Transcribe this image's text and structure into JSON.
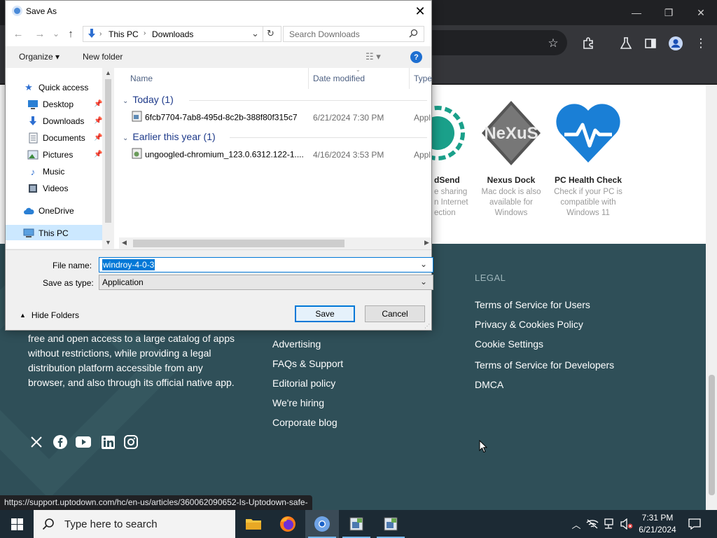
{
  "browser": {
    "window_controls": {
      "minimize": "—",
      "maximize": "❐",
      "close": "✕"
    }
  },
  "page": {
    "apps": [
      {
        "name": "dSend",
        "desc": "e sharing\nn Internet\nection"
      },
      {
        "name": "Nexus Dock",
        "logo_text": "NeXuS",
        "desc": "Mac dock is also available for Windows"
      },
      {
        "name": "PC Health Check",
        "desc": "Check if your PC is compatible with Windows 11"
      }
    ],
    "about_text": "free and open access to a large catalog of apps without restrictions, while providing a legal distribution platform accessible from any browser, and also through its official native app.",
    "company_links": [
      "Advertising",
      "FAQs & Support",
      "Editorial policy",
      "We're hiring",
      "Corporate blog"
    ],
    "legal": {
      "heading": "LEGAL",
      "links": [
        "Terms of Service for Users",
        "Privacy & Cookies Policy",
        "Cookie Settings",
        "Terms of Service for Developers",
        "DMCA"
      ]
    },
    "social_icons": [
      "x-icon",
      "facebook-icon",
      "youtube-icon",
      "linkedin-icon",
      "instagram-icon"
    ],
    "status_url": "https://support.uptodown.com/hc/en-us/articles/360062090652-Is-Uptodown-safe-"
  },
  "dialog": {
    "title": "Save As",
    "breadcrumb": [
      "This PC",
      "Downloads"
    ],
    "search_placeholder": "Search Downloads",
    "organize_label": "Organize ▾",
    "new_folder_label": "New folder",
    "nav_items": [
      {
        "label": "Quick access",
        "icon": "star-icon"
      },
      {
        "label": "Desktop",
        "icon": "desktop-icon",
        "pinned": true
      },
      {
        "label": "Downloads",
        "icon": "download-icon",
        "pinned": true
      },
      {
        "label": "Documents",
        "icon": "document-icon",
        "pinned": true
      },
      {
        "label": "Pictures",
        "icon": "picture-icon",
        "pinned": true
      },
      {
        "label": "Music",
        "icon": "music-icon"
      },
      {
        "label": "Videos",
        "icon": "video-icon"
      },
      {
        "label": "OneDrive",
        "icon": "cloud-icon"
      },
      {
        "label": "This PC",
        "icon": "computer-icon",
        "selected": true
      }
    ],
    "columns": [
      "Name",
      "Date modified",
      "Type"
    ],
    "groups": [
      {
        "label": "Today (1)",
        "files": [
          {
            "name": "6fcb7704-7ab8-495d-8c2b-388f80f315c7",
            "date": "6/21/2024 7:30 PM",
            "type": "Appl"
          }
        ]
      },
      {
        "label": "Earlier this year (1)",
        "files": [
          {
            "name": "ungoogled-chromium_123.0.6312.122-1....",
            "date": "4/16/2024 3:53 PM",
            "type": "Appl"
          }
        ]
      }
    ],
    "file_name_label": "File name:",
    "file_name_value": "windroy-4-0-3",
    "save_type_label": "Save as type:",
    "save_type_value": "Application",
    "hide_folders_label": "Hide Folders",
    "save_label": "Save",
    "cancel_label": "Cancel"
  },
  "taskbar": {
    "search_placeholder": "Type here to search",
    "time": "7:31 PM",
    "date": "6/21/2024"
  },
  "colors": {
    "footer_bg": "#2f4f58",
    "accent": "#0078d7",
    "taskbar_bg": "#1c2a34"
  }
}
